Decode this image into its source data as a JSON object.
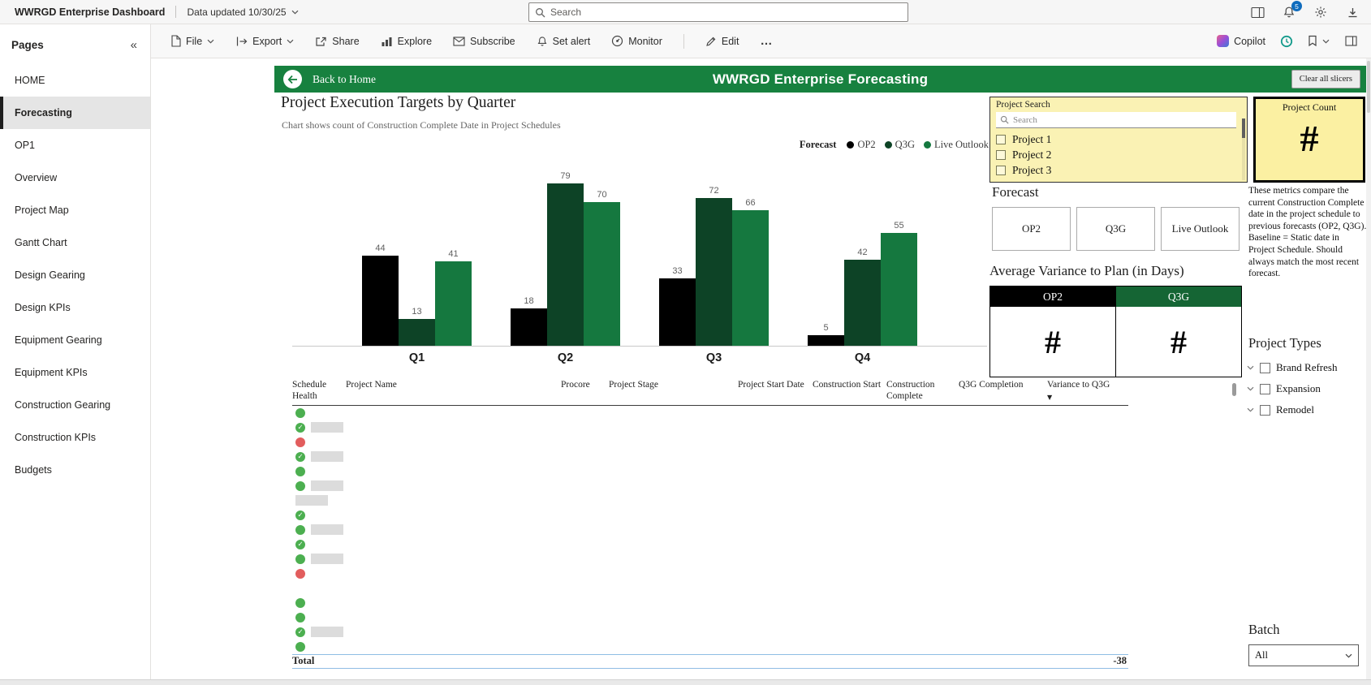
{
  "colors": {
    "header_green": "#17813f",
    "status_green": "#4caf50",
    "status_red": "#e25d5d"
  },
  "top_bar": {
    "app_title": "WWRGD Enterprise Dashboard",
    "data_updated": "Data updated 10/30/25",
    "search_placeholder": "Search",
    "notification_count": "5"
  },
  "toolbar": {
    "file": "File",
    "export": "Export",
    "share": "Share",
    "explore": "Explore",
    "subscribe": "Subscribe",
    "set_alert": "Set alert",
    "monitor": "Monitor",
    "edit": "Edit",
    "more": "…",
    "copilot": "Copilot"
  },
  "sidebar": {
    "title": "Pages",
    "collapse": "«",
    "items": [
      {
        "label": "HOME",
        "selected": false
      },
      {
        "label": "Forecasting",
        "selected": true
      },
      {
        "label": "OP1",
        "selected": false
      },
      {
        "label": "Overview",
        "selected": false
      },
      {
        "label": "Project Map",
        "selected": false
      },
      {
        "label": "Gantt Chart",
        "selected": false
      },
      {
        "label": "Design Gearing",
        "selected": false
      },
      {
        "label": "Design KPIs",
        "selected": false
      },
      {
        "label": "Equipment Gearing",
        "selected": false
      },
      {
        "label": "Equipment KPIs",
        "selected": false
      },
      {
        "label": "Construction Gearing",
        "selected": false
      },
      {
        "label": "Construction KPIs",
        "selected": false
      },
      {
        "label": "Budgets",
        "selected": false
      }
    ]
  },
  "report": {
    "back_label": "Back to Home",
    "title": "WWRGD Enterprise Forecasting",
    "clear_slicers": "Clear all slicers"
  },
  "chart_data": {
    "type": "bar",
    "title": "Project Execution Targets by Quarter",
    "subtitle": "Chart shows count of Construction Complete Date in Project Schedules",
    "legend_title": "Forecast",
    "legend_position": "top-right",
    "categories": [
      "Q1",
      "Q2",
      "Q3",
      "Q4"
    ],
    "series": [
      {
        "name": "OP2",
        "color": "#000000",
        "values": [
          44,
          18,
          33,
          5
        ]
      },
      {
        "name": "Q3G",
        "color": "#0d4326",
        "values": [
          13,
          79,
          72,
          42
        ]
      },
      {
        "name": "Live Outlook",
        "color": "#15783f",
        "values": [
          41,
          70,
          66,
          55
        ]
      }
    ],
    "ylim": [
      0,
      85
    ],
    "y_axis_visible": false,
    "value_labels": true
  },
  "table": {
    "columns": [
      "Schedule Health",
      "Project Name",
      "Procore",
      "Project Stage",
      "Project Start Date",
      "Construction Start",
      "Construction Complete",
      "Q3G Completion",
      "Variance to Q3G"
    ],
    "sorted_column": "Variance to Q3G",
    "rows": [
      {
        "health": "green",
        "redacted": false
      },
      {
        "health": "green-check",
        "redacted": true
      },
      {
        "health": "red",
        "redacted": false
      },
      {
        "health": "green-check",
        "redacted": true
      },
      {
        "health": "green",
        "redacted": false
      },
      {
        "health": "green",
        "redacted": true
      },
      {
        "health": null,
        "redacted": true
      },
      {
        "health": "green-check",
        "redacted": false
      },
      {
        "health": "green",
        "redacted": true
      },
      {
        "health": "green-check",
        "redacted": false
      },
      {
        "health": "green",
        "redacted": true
      },
      {
        "health": "red",
        "redacted": false
      },
      {
        "health": null,
        "redacted": false
      },
      {
        "health": "green",
        "redacted": false
      },
      {
        "health": "green",
        "redacted": false
      },
      {
        "health": "green-check",
        "redacted": true
      },
      {
        "health": "green",
        "redacted": false
      }
    ],
    "total_label": "Total",
    "total_variance": "-38"
  },
  "right_panel": {
    "project_search": {
      "title": "Project Search",
      "placeholder": "Search",
      "items": [
        "Project 1",
        "Project 2",
        "Project 3"
      ]
    },
    "project_count": {
      "title": "Project Count",
      "value": "#"
    },
    "forecast": {
      "title": "Forecast",
      "buttons": [
        "OP2",
        "Q3G",
        "Live Outlook"
      ]
    },
    "metrics_note": "These metrics compare the current Construction Complete date in the project schedule to previous forecasts (OP2, Q3G). Baseline = Static date in Project Schedule. Should always match the most recent forecast.",
    "avg_variance": {
      "title": "Average Variance to Plan (in Days)",
      "cards": [
        {
          "label": "OP2",
          "value": "#",
          "header_color": "#000000"
        },
        {
          "label": "Q3G",
          "value": "#",
          "header_color": "#156534"
        }
      ]
    },
    "project_types": {
      "title": "Project Types",
      "items": [
        "Brand Refresh",
        "Expansion",
        "Remodel"
      ]
    },
    "batch": {
      "title": "Batch",
      "selected": "All"
    }
  }
}
